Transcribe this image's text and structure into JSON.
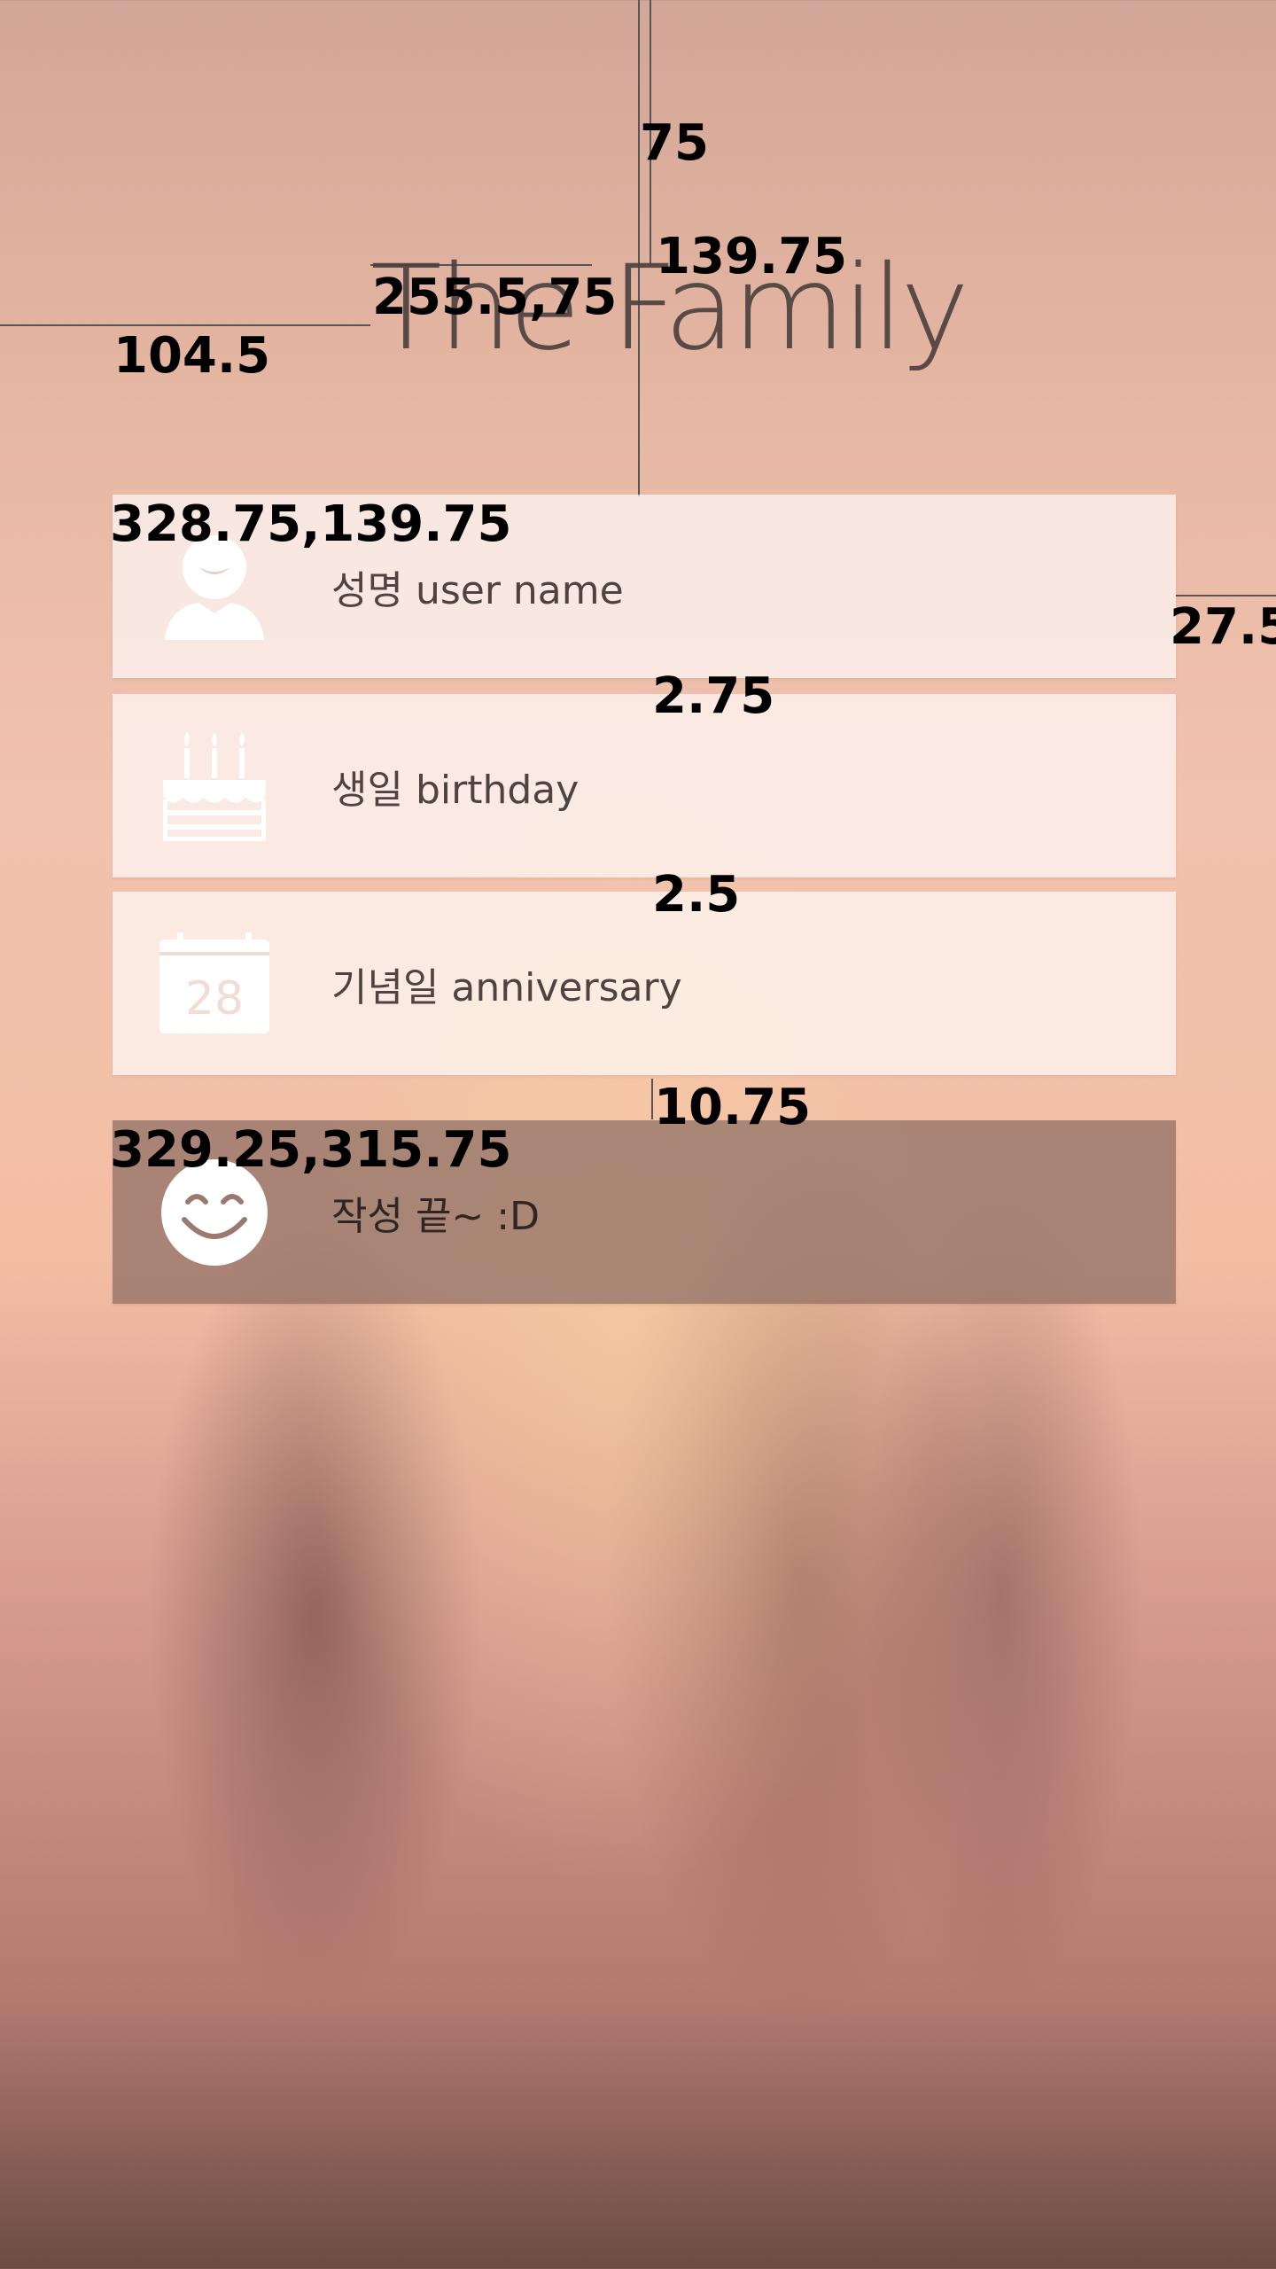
{
  "app": {
    "title": "The Family"
  },
  "items": [
    {
      "label": "성명 user name",
      "icon": "user-icon"
    },
    {
      "label": "생일 birthday",
      "icon": "cake-icon"
    },
    {
      "label": "기념일 anniversary",
      "icon": "calendar-icon",
      "icon_text": "28"
    },
    {
      "label": "작성 끝~ :D",
      "icon": "smile-icon"
    }
  ],
  "annotations": {
    "top_gap": "75",
    "title_to_card": "139.75",
    "title_pos": "255.5,75",
    "left_margin": "104.5",
    "card1_pos": "328.75,139.75",
    "right_margin": "27.5",
    "gap_1": "2.75",
    "gap_2": "2.5",
    "gap_3": "10.75",
    "card4_pos": "329.25,315.75"
  },
  "colors": {
    "card_bg": "#f3e3de",
    "done_bg": "#9a7a6f",
    "text": "#4f4341"
  }
}
